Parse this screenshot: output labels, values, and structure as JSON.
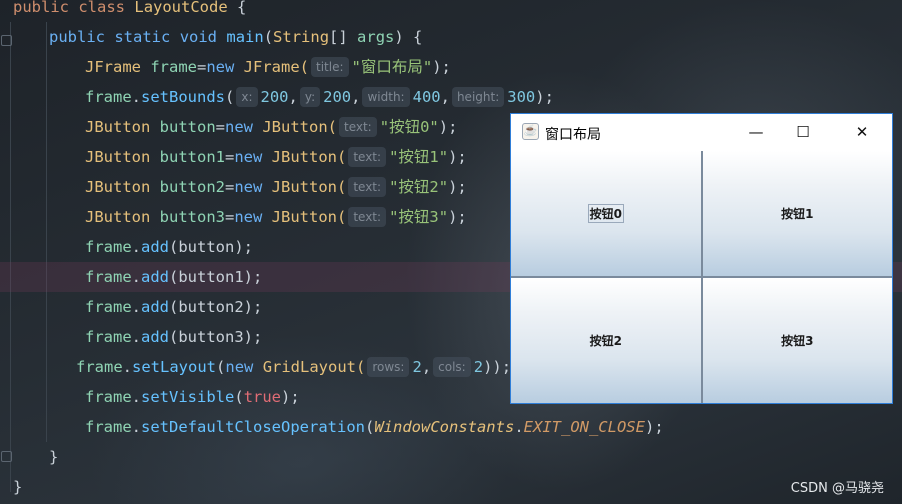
{
  "editor": {
    "line1": {
      "kw1": "public",
      "kw2": "class",
      "name": "LayoutCode",
      "brace": " {"
    },
    "line2": {
      "kw1": "public",
      "kw2": "static",
      "kw3": "void",
      "fn": "main",
      "p1": "(",
      "type": "String",
      "p2": "[] ",
      "arg": "args",
      "p3": ") {"
    },
    "line3": {
      "type": "JFrame",
      "var": " frame",
      "eq": "=",
      "kw": "new",
      "ctor": " JFrame(",
      "hint": "title:",
      "str": "\"窗口布局\"",
      "end": ");"
    },
    "line4": {
      "obj": "frame",
      "dot": ".",
      "fn": "setBounds",
      "p": "(",
      "h1": "x:",
      "v1": "200",
      "c1": ",",
      "h2": "y:",
      "v2": "200",
      "c2": ",",
      "h3": "width:",
      "v3": "400",
      "c3": ",",
      "h4": "height:",
      "v4": "300",
      "end": ");"
    },
    "line5": {
      "type": "JButton",
      "var": " button",
      "eq": "=",
      "kw": "new",
      "ctor": " JButton(",
      "hint": "text:",
      "str": "\"按钮0\"",
      "end": ");"
    },
    "line6": {
      "type": "JButton",
      "var": " button1",
      "eq": "=",
      "kw": "new",
      "ctor": " JButton(",
      "hint": "text:",
      "str": "\"按钮1\"",
      "end": ");"
    },
    "line7": {
      "type": "JButton",
      "var": " button2",
      "eq": "=",
      "kw": "new",
      "ctor": " JButton(",
      "hint": "text:",
      "str": "\"按钮2\"",
      "end": ");"
    },
    "line8": {
      "type": "JButton",
      "var": " button3",
      "eq": "=",
      "kw": "new",
      "ctor": " JButton(",
      "hint": "text:",
      "str": "\"按钮3\"",
      "end": ");"
    },
    "line9": {
      "obj": "frame",
      "dot": ".",
      "fn": "add",
      "args": "(button);"
    },
    "line10": {
      "obj": "frame",
      "dot": ".",
      "fn": "add",
      "args": "(button1);"
    },
    "line11": {
      "obj": "frame",
      "dot": ".",
      "fn": "add",
      "args": "(button2);"
    },
    "line12": {
      "obj": "frame",
      "dot": ".",
      "fn": "add",
      "args": "(button3);"
    },
    "line13": {
      "obj": "frame",
      "dot": ".",
      "fn": "setLayout",
      "p": "(",
      "kw": "new",
      "ctor": " GridLayout(",
      "h1": "rows:",
      "v1": "2",
      "c1": ",",
      "h2": "cols:",
      "v2": "2",
      "end": "));"
    },
    "line14": {
      "obj": "frame",
      "dot": ".",
      "fn": "setVisible",
      "p": "(",
      "val": "true",
      "end": ");"
    },
    "line15": {
      "obj": "frame",
      "dot": ".",
      "fn": "setDefaultCloseOperation",
      "p": "(",
      "cls": "WindowConstants",
      "dot2": ".",
      "const": "EXIT_ON_CLOSE",
      "end": ");"
    },
    "line16": {
      "brace": "}"
    },
    "line17": {
      "brace": "}"
    }
  },
  "window": {
    "title": "窗口布局",
    "icon": "java-icon",
    "minimize": "—",
    "maximize": "☐",
    "close": "✕",
    "buttons": [
      "按钮0",
      "按钮1",
      "按钮2",
      "按钮3"
    ]
  },
  "watermark": "CSDN @马骁尧"
}
